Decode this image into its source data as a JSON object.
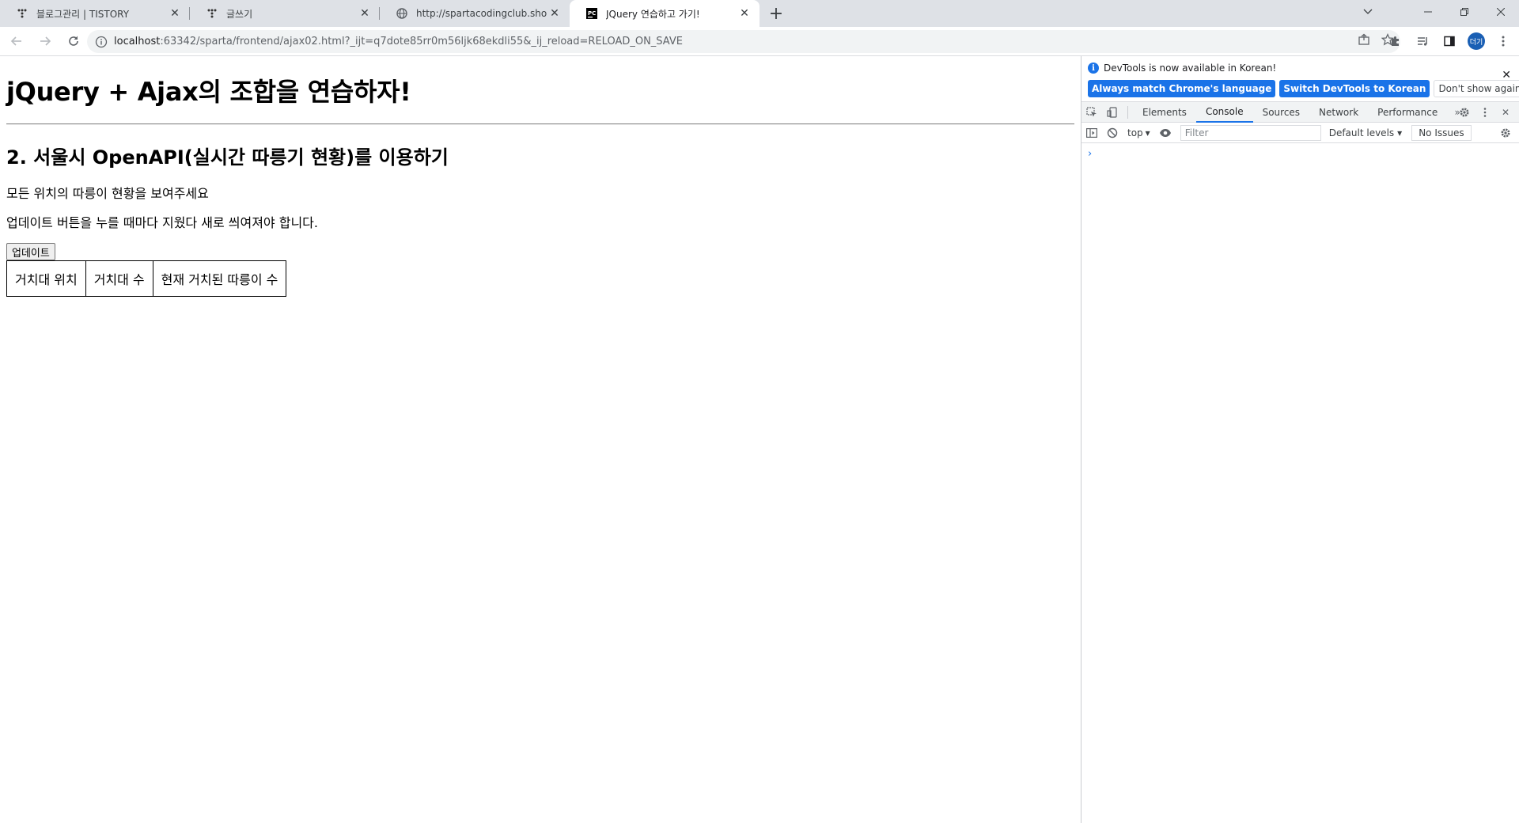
{
  "tabs": [
    {
      "title": "블로그관리 | TISTORY",
      "icon": "tistory-icon"
    },
    {
      "title": "글쓰기",
      "icon": "tistory-icon"
    },
    {
      "title": "http://spartacodingclub.shop/sp",
      "icon": "globe-icon"
    },
    {
      "title": "JQuery 연습하고 가기!",
      "icon": "pycharm-icon",
      "active": true
    }
  ],
  "toolbar": {
    "url_host": "localhost",
    "url_rest": ":63342/sparta/frontend/ajax02.html?_ijt=q7dote85rr0m56ljk68ekdli55&_ij_reload=RELOAD_ON_SAVE",
    "avatar_text": "더기"
  },
  "page": {
    "h1": "jQuery + Ajax의 조합을 연습하자!",
    "h2": "2. 서울시 OpenAPI(실시간 따릉기 현황)를 이용하기",
    "p1": "모든 위치의 따릉이 현황을 보여주세요",
    "p2": "업데이트 버튼을 누를 때마다 지웠다 새로 씌여져야 합니다.",
    "button": "업데이트",
    "table_headers": [
      "거치대 위치",
      "거치대 수",
      "현재 거치된 따릉이 수"
    ]
  },
  "devtools": {
    "banner_message": "DevTools is now available in Korean!",
    "btn_match": "Always match Chrome's language",
    "btn_switch": "Switch DevTools to Korean",
    "btn_dont_show": "Don't show again",
    "tabs": [
      "Elements",
      "Console",
      "Sources",
      "Network",
      "Performance"
    ],
    "active_tab": "Console",
    "context": "top",
    "filter_placeholder": "Filter",
    "levels": "Default levels",
    "issues": "No Issues",
    "prompt": "›"
  },
  "colors": {
    "accent": "#1a73e8",
    "tabstrip": "#dee1e6"
  }
}
